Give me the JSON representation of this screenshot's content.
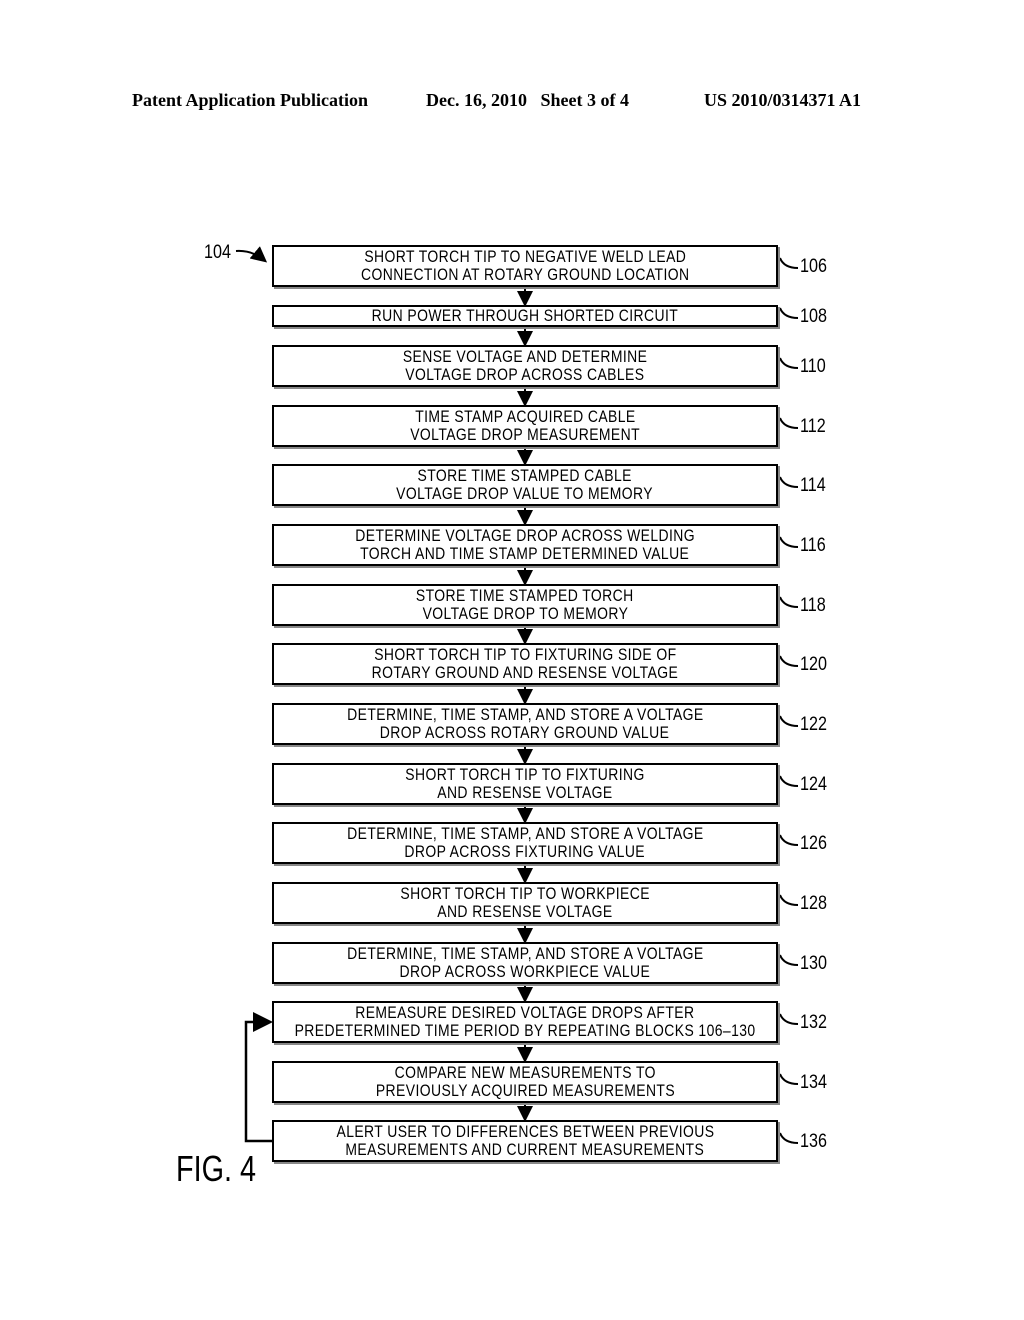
{
  "header": {
    "left": "Patent Application Publication",
    "date_sheet": "Dec. 16, 2010   Sheet 3 of 4",
    "pub_number": "US 2010/0314371 A1"
  },
  "flowchart": {
    "label": "104",
    "figure_label": "FIG. 4",
    "loop_back": {
      "from": "136",
      "to": "132"
    },
    "steps": [
      {
        "ref": "106",
        "lines": [
          "SHORT TORCH TIP TO NEGATIVE WELD LEAD",
          "CONNECTION AT ROTARY GROUND LOCATION"
        ]
      },
      {
        "ref": "108",
        "lines": [
          "RUN POWER THROUGH SHORTED CIRCUIT"
        ]
      },
      {
        "ref": "110",
        "lines": [
          "SENSE VOLTAGE AND DETERMINE",
          "VOLTAGE DROP ACROSS CABLES"
        ]
      },
      {
        "ref": "112",
        "lines": [
          "TIME STAMP ACQUIRED CABLE",
          "VOLTAGE DROP MEASUREMENT"
        ]
      },
      {
        "ref": "114",
        "lines": [
          "STORE TIME STAMPED CABLE",
          "VOLTAGE DROP VALUE TO MEMORY"
        ]
      },
      {
        "ref": "116",
        "lines": [
          "DETERMINE VOLTAGE DROP ACROSS WELDING",
          "TORCH AND TIME STAMP DETERMINED VALUE"
        ]
      },
      {
        "ref": "118",
        "lines": [
          "STORE TIME STAMPED TORCH",
          "VOLTAGE DROP TO MEMORY"
        ]
      },
      {
        "ref": "120",
        "lines": [
          "SHORT TORCH TIP TO FIXTURING SIDE OF",
          "ROTARY GROUND AND RESENSE VOLTAGE"
        ]
      },
      {
        "ref": "122",
        "lines": [
          "DETERMINE, TIME STAMP, AND STORE A VOLTAGE",
          "DROP ACROSS ROTARY GROUND VALUE"
        ]
      },
      {
        "ref": "124",
        "lines": [
          "SHORT TORCH TIP TO FIXTURING",
          "AND RESENSE VOLTAGE"
        ]
      },
      {
        "ref": "126",
        "lines": [
          "DETERMINE, TIME STAMP, AND STORE A VOLTAGE",
          "DROP ACROSS FIXTURING VALUE"
        ]
      },
      {
        "ref": "128",
        "lines": [
          "SHORT TORCH TIP TO WORKPIECE",
          "AND RESENSE VOLTAGE"
        ]
      },
      {
        "ref": "130",
        "lines": [
          "DETERMINE, TIME STAMP, AND STORE A VOLTAGE",
          "DROP ACROSS WORKPIECE VALUE"
        ]
      },
      {
        "ref": "132",
        "lines": [
          "REMEASURE DESIRED VOLTAGE DROPS AFTER",
          "PREDETERMINED TIME PERIOD BY REPEATING BLOCKS 106–130"
        ]
      },
      {
        "ref": "134",
        "lines": [
          "COMPARE NEW  MEASUREMENTS TO",
          "PREVIOUSLY ACQUIRED MEASUREMENTS"
        ]
      },
      {
        "ref": "136",
        "lines": [
          "ALERT USER TO DIFFERENCES BETWEEN PREVIOUS",
          "MEASUREMENTS AND CURRENT MEASUREMENTS"
        ]
      }
    ]
  }
}
